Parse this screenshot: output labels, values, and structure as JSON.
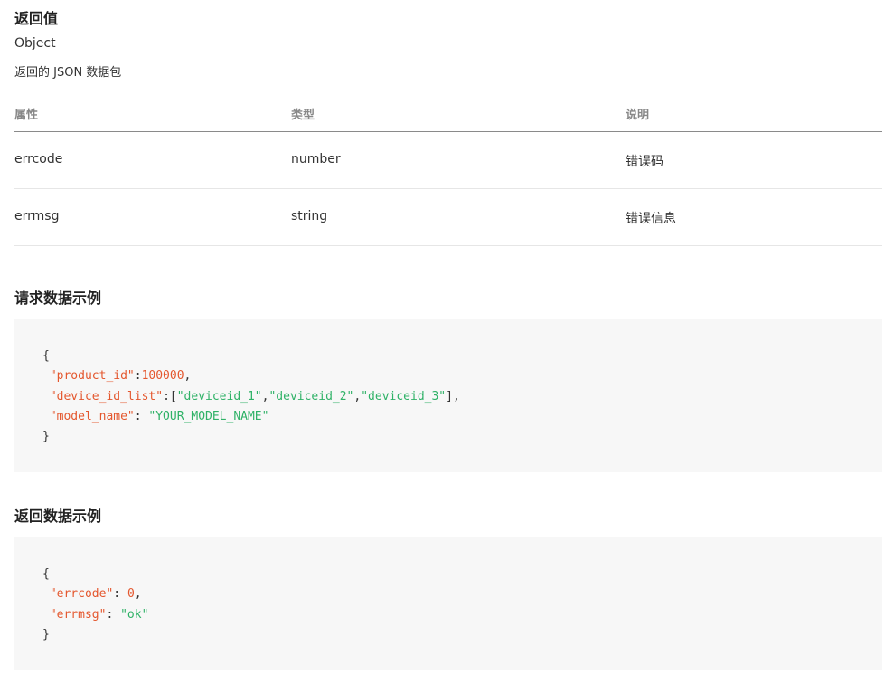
{
  "return_section": {
    "title": "返回值",
    "type": "Object",
    "description": "返回的 JSON 数据包"
  },
  "table": {
    "headers": [
      "属性",
      "类型",
      "说明"
    ],
    "rows": [
      {
        "name": "errcode",
        "type": "number",
        "desc": "错误码"
      },
      {
        "name": "errmsg",
        "type": "string",
        "desc": "错误信息"
      }
    ]
  },
  "request_example": {
    "title": "请求数据示例",
    "open": "{",
    "close": "}",
    "product_id_key": "\"product_id\"",
    "product_id_value": "100000",
    "device_id_list_key": "\"device_id_list\"",
    "device_ids": [
      "\"deviceid_1\"",
      "\"deviceid_2\"",
      "\"deviceid_3\""
    ],
    "model_name_key": "\"model_name\"",
    "model_name_value": "\"YOUR_MODEL_NAME\""
  },
  "response_example": {
    "title": "返回数据示例",
    "open": "{",
    "close": "}",
    "errcode_key": "\"errcode\"",
    "errcode_value": "0",
    "errmsg_key": "\"errmsg\"",
    "errmsg_value": "\"ok\""
  },
  "colors": {
    "key": "#e4572e",
    "string": "#2fb267",
    "code_bg": "#f7f7f7"
  }
}
